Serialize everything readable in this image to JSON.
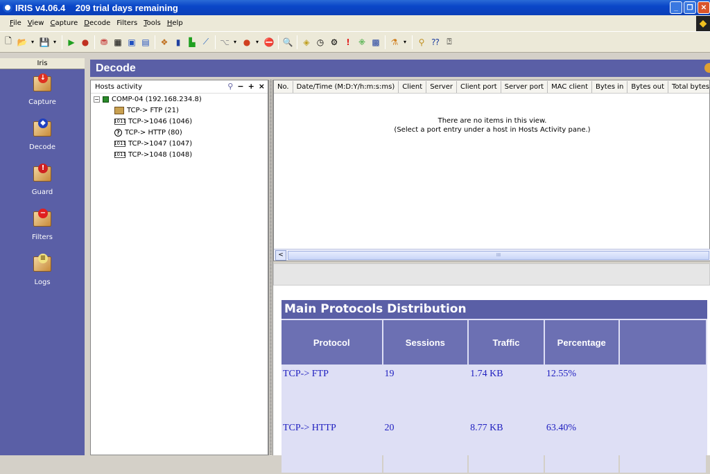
{
  "window": {
    "title": "IRIS v4.06.4    209 trial days remaining"
  },
  "menubar": {
    "items": [
      {
        "u": "F",
        "rest": "ile"
      },
      {
        "u": "V",
        "rest": "iew"
      },
      {
        "u": "C",
        "rest": "apture"
      },
      {
        "u": "D",
        "rest": "ecode"
      },
      {
        "u": "",
        "rest": "Filters"
      },
      {
        "u": "T",
        "rest": "ools"
      },
      {
        "u": "H",
        "rest": "elp"
      }
    ]
  },
  "sidebar": {
    "header": "Iris",
    "items": [
      {
        "label": "Capture",
        "icon": "capture-icon"
      },
      {
        "label": "Decode",
        "icon": "decode-icon"
      },
      {
        "label": "Guard",
        "icon": "guard-icon"
      },
      {
        "label": "Filters",
        "icon": "filters-icon"
      },
      {
        "label": "Logs",
        "icon": "logs-icon"
      }
    ]
  },
  "decode": {
    "title": "Decode"
  },
  "hosts": {
    "title": "Hosts activity",
    "tools": [
      "⚲",
      "−",
      "+",
      "×"
    ],
    "root": {
      "expander": "−",
      "label": "COMP-04 (192.168.234.8)"
    },
    "children": [
      {
        "icon": "ftp",
        "icon_text": "",
        "label": "TCP-> FTP (21)"
      },
      {
        "icon": "bin",
        "icon_text": "1011",
        "label": "TCP->1046 (1046)"
      },
      {
        "icon": "q",
        "icon_text": "?",
        "label": "TCP-> HTTP (80)"
      },
      {
        "icon": "bin",
        "icon_text": "1011",
        "label": "TCP->1047 (1047)"
      },
      {
        "icon": "bin",
        "icon_text": "1011",
        "label": "TCP->1048 (1048)"
      }
    ]
  },
  "list": {
    "columns": [
      "No.",
      "Date/Time (M:D:Y/h:m:s:ms)",
      "Client",
      "Server",
      "Client port",
      "Server port",
      "MAC client",
      "Bytes in",
      "Bytes out",
      "Total bytes"
    ],
    "empty_line1": "There are no items in this view.",
    "empty_line2": "(Select a port entry under a host in Hosts Activity pane.)",
    "scroll_left": "<",
    "scroll_grip": "III"
  },
  "report": {
    "title": "Main Protocols Distribution",
    "headers": [
      "Protocol",
      "Sessions",
      "Traffic",
      "Percentage",
      ""
    ],
    "rows": [
      [
        "TCP-> FTP",
        "19",
        "1.74 KB",
        "12.55%",
        ""
      ],
      [
        "TCP-> HTTP",
        "20",
        "8.77 KB",
        "63.40%",
        ""
      ]
    ]
  }
}
